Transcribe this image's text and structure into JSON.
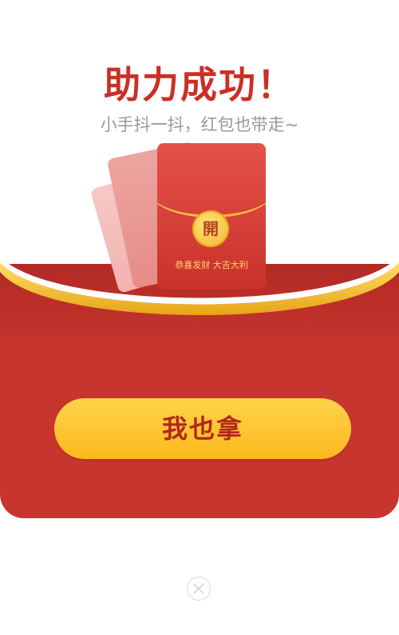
{
  "popup": {
    "title": "助力成功！",
    "subtitle": "小手抖一抖，红包也带走~",
    "envelope": {
      "coin_char": "開",
      "blessing": "恭喜发财 大吉大利"
    },
    "claim_button_label": "我也拿",
    "close_icon": "close-icon"
  },
  "colors": {
    "title_red": "#cc2f24",
    "envelope_red": "#c6352e",
    "gold_trim": "#f0c040",
    "button_gold": "#fcb81e",
    "button_text": "#b3271d"
  }
}
